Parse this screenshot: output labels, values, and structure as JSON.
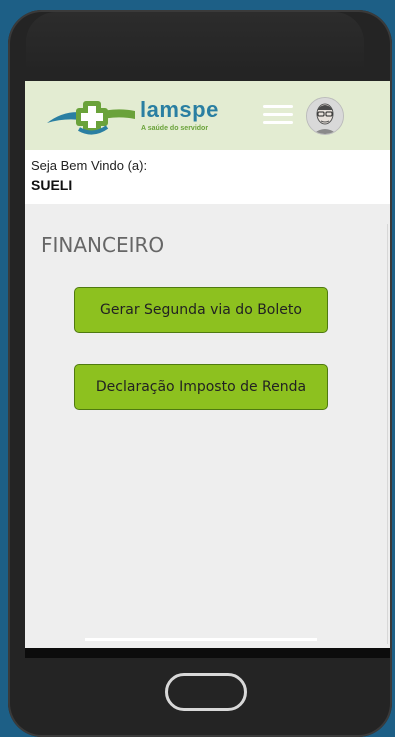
{
  "brand": {
    "name": "lamspe",
    "tagline": "A saúde do servidor"
  },
  "welcome": {
    "label": "Seja Bem Vindo (a):",
    "user": "SUELI"
  },
  "page": {
    "title": "FINANCEIRO"
  },
  "actions": [
    {
      "label": "Gerar Segunda via do Boleto"
    },
    {
      "label": "Declaração Imposto de Renda"
    }
  ],
  "icons": {
    "menu": "hamburger-menu-icon",
    "avatar": "user-avatar"
  },
  "colors": {
    "header_bg": "#e3ecd2",
    "button_green": "#8dc11f",
    "brand_blue": "#2a7fa2",
    "brand_green": "#6aa23a"
  }
}
